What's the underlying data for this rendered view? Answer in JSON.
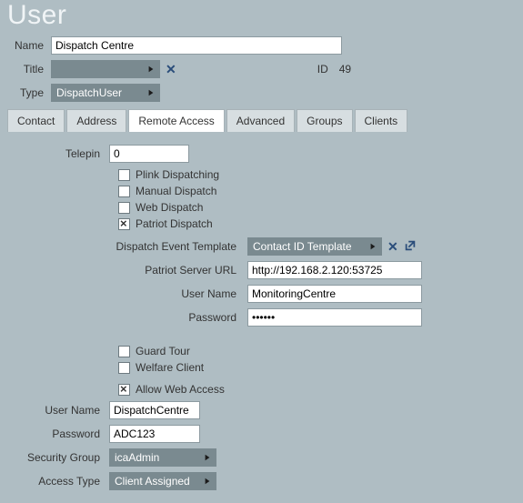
{
  "page_title": "User",
  "header": {
    "name_label": "Name",
    "name_value": "Dispatch Centre",
    "title_label": "Title",
    "title_value": "",
    "id_label": "ID",
    "id_value": "49",
    "type_label": "Type",
    "type_value": "DispatchUser"
  },
  "tabs": {
    "contact": "Contact",
    "address": "Address",
    "remote": "Remote Access",
    "advanced": "Advanced",
    "groups": "Groups",
    "clients": "Clients"
  },
  "remote": {
    "telepin_label": "Telepin",
    "telepin_value": "0",
    "chk_plink": "Plink Dispatching",
    "chk_manual": "Manual Dispatch",
    "chk_web": "Web Dispatch",
    "chk_patriot": "Patriot Dispatch",
    "template_label": "Dispatch Event Template",
    "template_value": "Contact ID Template",
    "url_label": "Patriot Server URL",
    "url_value": "http://192.168.2.120:53725",
    "uname_label": "User Name",
    "uname_value": "MonitoringCentre",
    "pass_label": "Password",
    "pass_value": "••••••",
    "chk_guard": "Guard Tour",
    "chk_welfare": "Welfare Client",
    "chk_allowweb": "Allow Web Access"
  },
  "web": {
    "uname_label": "User Name",
    "uname_value": "DispatchCentre",
    "pass_label": "Password",
    "pass_value": "ADC123",
    "secgroup_label": "Security Group",
    "secgroup_value": "icaAdmin",
    "access_label": "Access Type",
    "access_value": "Client Assigned"
  }
}
